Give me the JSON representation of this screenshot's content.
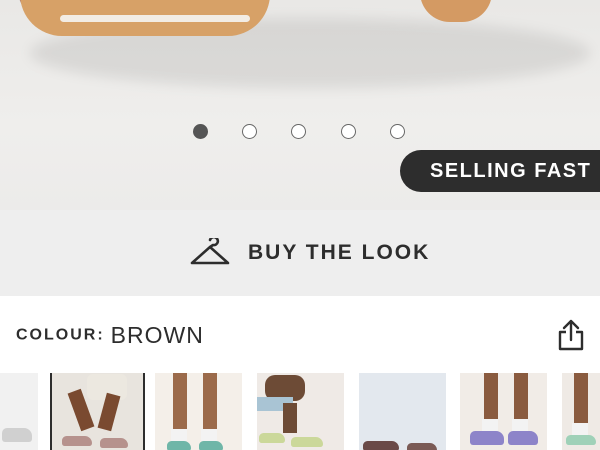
{
  "hero": {
    "carousel": {
      "count": 5,
      "active_index": 0
    },
    "badge": "SELLING FAST"
  },
  "buy_the_look": {
    "label": "BUY THE LOOK",
    "icon": "hanger-icon"
  },
  "colour": {
    "label": "COLOUR:",
    "value": "BROWN",
    "share_icon": "share-icon"
  },
  "thumbnails": {
    "selected_index": 1,
    "items": [
      {
        "name": "thumb-1"
      },
      {
        "name": "thumb-2"
      },
      {
        "name": "thumb-3"
      },
      {
        "name": "thumb-4"
      },
      {
        "name": "thumb-5"
      },
      {
        "name": "thumb-6"
      },
      {
        "name": "thumb-7"
      }
    ]
  },
  "colors": {
    "badge_bg": "#2d2d2d",
    "bar_bg": "#eeeeee",
    "text": "#2d2d2d"
  }
}
